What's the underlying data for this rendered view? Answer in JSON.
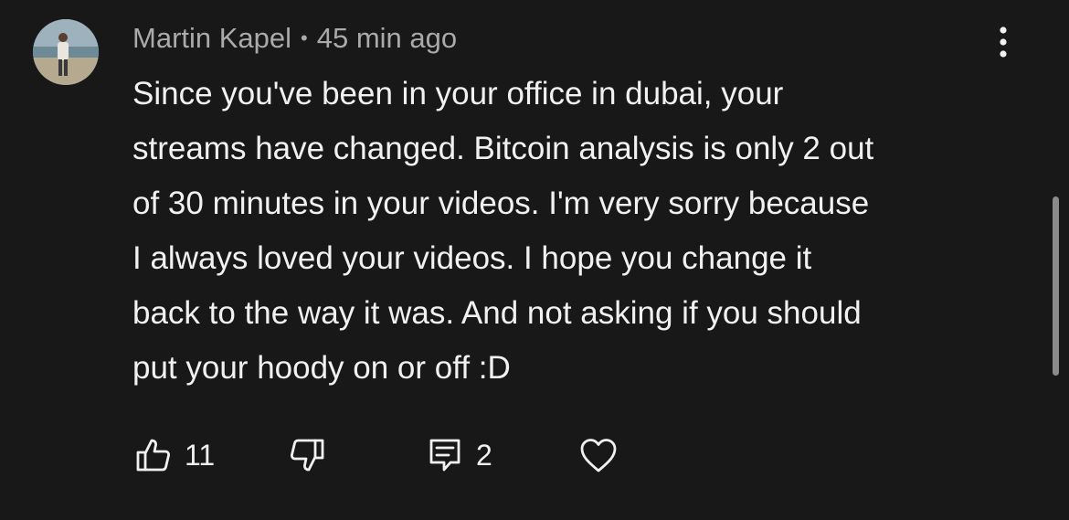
{
  "comment": {
    "author": "Martin Kapel",
    "separator": "•",
    "timestamp": "45 min ago",
    "text": "Since you've been in your office in dubai, your\nstreams have changed. Bitcoin analysis is only 2 out\nof 30 minutes in your videos. I'm very sorry because\nI always loved your videos. I hope you change it\nback to the way it was. And not asking if you should\nput your hoody on or off :D",
    "like_count": "11",
    "reply_count": "2"
  },
  "icons": {
    "menu": "more-vert-icon",
    "like": "thumb-up-icon",
    "dislike": "thumb-down-icon",
    "reply": "reply-comment-icon",
    "heart": "heart-icon"
  },
  "colors": {
    "background": "#181818",
    "text": "#f1f1f1",
    "meta": "#aaaaaa"
  }
}
